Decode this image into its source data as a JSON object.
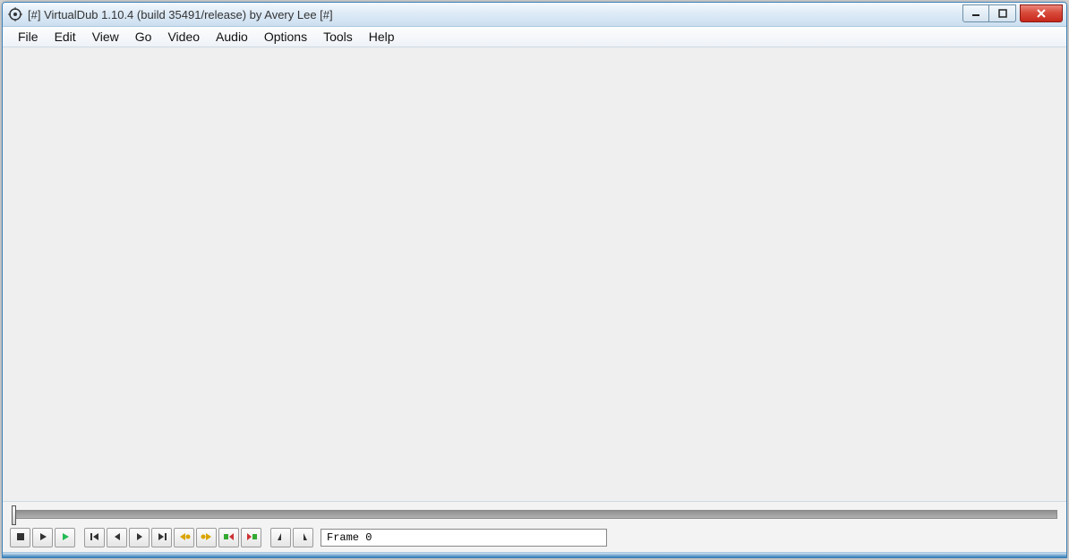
{
  "titlebar": {
    "title": "[#] VirtualDub 1.10.4 (build 35491/release) by Avery Lee [#]"
  },
  "menu": {
    "items": [
      "File",
      "Edit",
      "View",
      "Go",
      "Video",
      "Audio",
      "Options",
      "Tools",
      "Help"
    ]
  },
  "toolbar": {
    "frame_label": "Frame 0",
    "buttons": [
      {
        "name": "stop-button"
      },
      {
        "name": "play-input-button"
      },
      {
        "name": "play-output-button"
      },
      {
        "name": "seek-start-button"
      },
      {
        "name": "step-back-button"
      },
      {
        "name": "step-forward-button"
      },
      {
        "name": "seek-end-button"
      },
      {
        "name": "key-prev-button"
      },
      {
        "name": "key-next-button"
      },
      {
        "name": "scene-prev-button"
      },
      {
        "name": "scene-next-button"
      },
      {
        "name": "mark-in-button"
      },
      {
        "name": "mark-out-button"
      }
    ]
  },
  "timeline": {
    "position": 0
  }
}
